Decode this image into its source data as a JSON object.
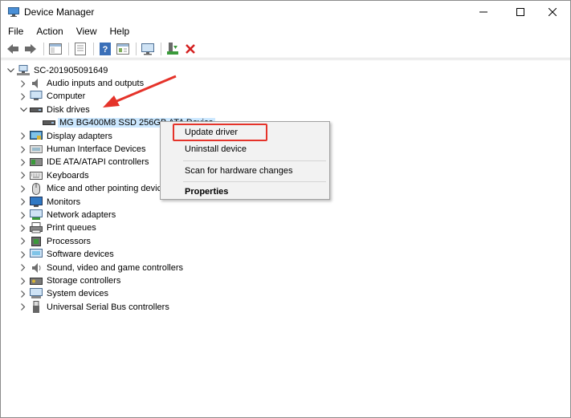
{
  "window": {
    "title": "Device Manager",
    "controls": [
      "minimize",
      "maximize",
      "close"
    ]
  },
  "menu": [
    "File",
    "Action",
    "View",
    "Help"
  ],
  "toolbar": {
    "buttons": [
      "back",
      "forward",
      "properties-view",
      "show-hide",
      "help",
      "properties",
      "scan-hardware",
      "update-driver",
      "uninstall"
    ]
  },
  "tree": {
    "root": "SC-201905091649",
    "items": [
      {
        "label": "Audio inputs and outputs",
        "icon": "speaker-icon",
        "expanded": false
      },
      {
        "label": "Computer",
        "icon": "computer-icon",
        "expanded": false
      },
      {
        "label": "Disk drives",
        "icon": "disk-icon",
        "expanded": true
      },
      {
        "label": "MG  BG400M8  SSD 256GB ATA Device",
        "icon": "disk-icon",
        "child": true,
        "selected": true
      },
      {
        "label": "Display adapters",
        "icon": "display-icon",
        "expanded": false
      },
      {
        "label": "Human Interface Devices",
        "icon": "hid-icon",
        "expanded": false
      },
      {
        "label": "IDE ATA/ATAPI controllers",
        "icon": "ide-icon",
        "expanded": false
      },
      {
        "label": "Keyboards",
        "icon": "keyboard-icon",
        "expanded": false
      },
      {
        "label": "Mice and other pointing devices",
        "icon": "mouse-icon",
        "expanded": false
      },
      {
        "label": "Monitors",
        "icon": "monitor-icon",
        "expanded": false
      },
      {
        "label": "Network adapters",
        "icon": "network-icon",
        "expanded": false
      },
      {
        "label": "Print queues",
        "icon": "printer-icon",
        "expanded": false
      },
      {
        "label": "Processors",
        "icon": "processor-icon",
        "expanded": false
      },
      {
        "label": "Software devices",
        "icon": "software-icon",
        "expanded": false
      },
      {
        "label": "Sound, video and game controllers",
        "icon": "sound-icon",
        "expanded": false
      },
      {
        "label": "Storage controllers",
        "icon": "storage-icon",
        "expanded": false
      },
      {
        "label": "System devices",
        "icon": "system-icon",
        "expanded": false
      },
      {
        "label": "Universal Serial Bus controllers",
        "icon": "usb-icon",
        "expanded": false
      }
    ]
  },
  "context_menu": {
    "items": [
      {
        "label": "Update driver",
        "bold": false,
        "highlighted": true
      },
      {
        "label": "Uninstall device",
        "bold": false
      },
      {
        "separator": true
      },
      {
        "label": "Scan for hardware changes",
        "bold": false
      },
      {
        "separator": true
      },
      {
        "label": "Properties",
        "bold": true
      }
    ]
  },
  "annotation": {
    "color": "#e5332a",
    "arrow_target": "Disk drives",
    "box_target": "Update driver"
  }
}
